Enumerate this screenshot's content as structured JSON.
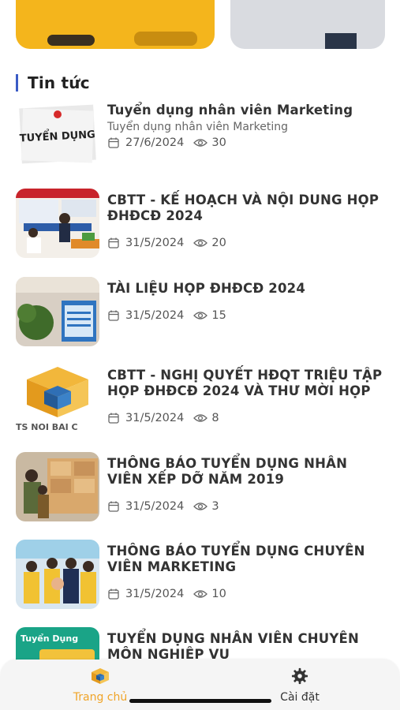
{
  "section": {
    "title": "Tin tức"
  },
  "news": [
    {
      "title": "Tuyển dụng nhân viên Marketing",
      "subtitle": "Tuyển dụng nhân viên Marketing",
      "date": "27/6/2024",
      "views": "30",
      "thumb_text": "TUYỂN DỤNG"
    },
    {
      "title": "CBTT - KẾ HOẠCH VÀ NỘI DUNG HỌP ĐHĐCĐ 2024",
      "subtitle": "",
      "date": "31/5/2024",
      "views": "20"
    },
    {
      "title": "TÀI LIỆU HỌP ĐHĐCĐ 2024",
      "subtitle": "",
      "date": "31/5/2024",
      "views": "15"
    },
    {
      "title": "CBTT - NGHỊ QUYẾT HĐQT TRIỆU TẬP HỌP ĐHĐCĐ 2024 VÀ THƯ MỜI HỌP",
      "subtitle": "",
      "date": "31/5/2024",
      "views": "8",
      "thumb_text": "TS NOI BAI C"
    },
    {
      "title": "THÔNG BÁO TUYỂN DỤNG NHÂN VIÊN XẾP DỠ NĂM 2019",
      "subtitle": "",
      "date": "31/5/2024",
      "views": "3"
    },
    {
      "title": "THÔNG BÁO TUYỂN DỤNG CHUYÊN VIÊN MARKETING",
      "subtitle": "",
      "date": "31/5/2024",
      "views": "10"
    },
    {
      "title": "TUYỂN DỤNG NHÂN VIÊN CHUYÊN MÔN NGHIỆP VỤ",
      "subtitle": "",
      "date": "",
      "views": "",
      "thumb_text": "Tuyển Dụng"
    }
  ],
  "nav": {
    "home_label": "Trang chủ",
    "settings_label": "Cài đặt",
    "active_color": "#f0a428"
  },
  "icons": {
    "date": "calendar-icon",
    "views": "eye-icon",
    "home": "home-cube-icon",
    "settings": "gear-icon"
  }
}
